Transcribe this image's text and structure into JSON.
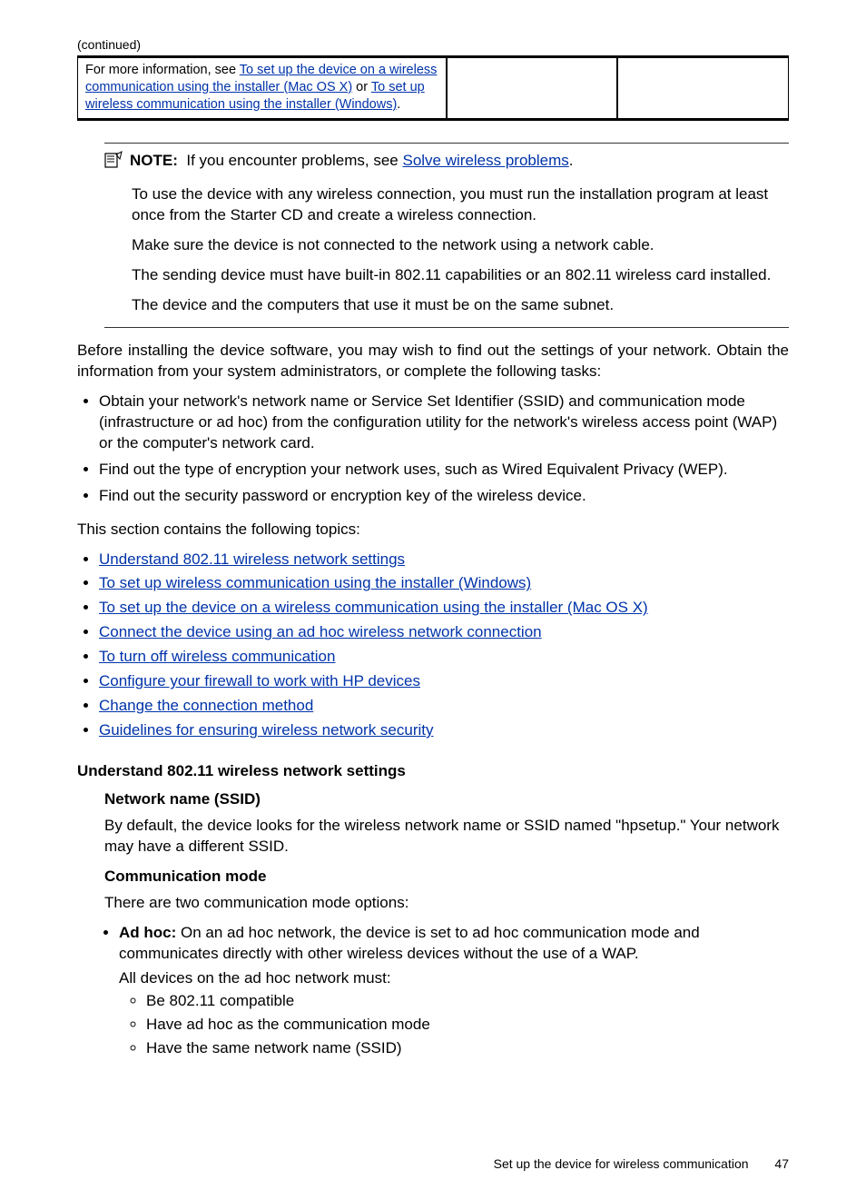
{
  "continued_label": "(continued)",
  "table": {
    "cell_left_pre": "For more information, see ",
    "cell_left_link1": "To set up the device on a wireless communication using the installer (Mac OS X)",
    "cell_left_mid": " or ",
    "cell_left_link2": "To set up wireless communication using the installer (Windows)",
    "cell_left_post": "."
  },
  "note": {
    "label": "NOTE:",
    "intro_pre": "If you encounter problems, see ",
    "intro_link": "Solve wireless problems",
    "p1": "To use the device with any wireless connection, you must run the installation program at least once from the Starter CD and create a wireless connection.",
    "p2": "Make sure the device is not connected to the network using a network cable.",
    "p3": "The sending device must have built-in 802.11 capabilities or an 802.11 wireless card installed.",
    "p4": "The device and the computers that use it must be on the same subnet."
  },
  "lead_para": "Before installing the device software, you may wish to find out the settings of your network. Obtain the information from your system administrators, or complete the following tasks:",
  "bullets": [
    "Obtain your network's network name or Service Set Identifier (SSID) and communication mode (infrastructure or ad hoc) from the configuration utility for the network's wireless access point (WAP) or the computer's network card.",
    "Find out the type of encryption your network uses, such as Wired Equivalent Privacy (WEP).",
    "Find out the security password or encryption key of the wireless device."
  ],
  "topics_intro": "This section contains the following topics:",
  "topics": [
    "Understand 802.11 wireless network settings",
    "To set up wireless communication using the installer (Windows)",
    "To set up the device on a wireless communication using the installer (Mac OS X)",
    "Connect the device using an ad hoc wireless network connection",
    "To turn off wireless communication",
    "Configure your firewall to work with HP devices",
    "Change the connection method",
    "Guidelines for ensuring wireless network security"
  ],
  "section_heading": "Understand 802.11 wireless network settings",
  "ssid": {
    "title": "Network name (SSID)",
    "para": "By default, the device looks for the wireless network name or SSID named \"hpsetup.\" Your network may have a different SSID."
  },
  "comm": {
    "title": "Communication mode",
    "intro": "There are two communication mode options:",
    "adhoc_label": "Ad hoc:",
    "adhoc_text": " On an ad hoc network, the device is set to ad hoc communication mode and communicates directly with other wireless devices without the use of a WAP.",
    "adhoc_line2": "All devices on the ad hoc network must:",
    "sub": [
      "Be 802.11 compatible",
      "Have ad hoc as the communication mode",
      "Have the same network name (SSID)"
    ]
  },
  "footer_text": "Set up the device for wireless communication",
  "page_number": "47"
}
